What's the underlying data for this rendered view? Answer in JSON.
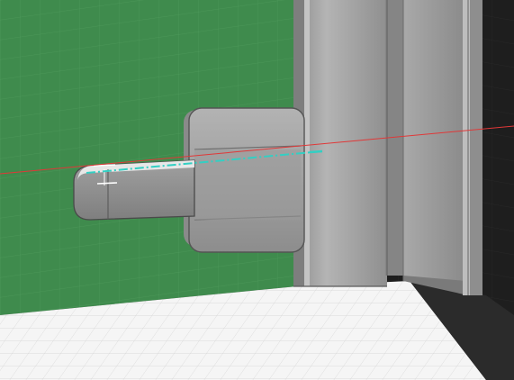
{
  "viewport": {
    "colors": {
      "background_dark": "#1e1e1e",
      "wall_green": "#3e8b4c",
      "floor_white": "#f4f4f4",
      "grid_line": "#d8d8d8",
      "metal_light": "#b9b9b9",
      "metal_mid": "#9c9c9c",
      "metal_dark": "#6f6f6f",
      "axis_x": "#e23a3a",
      "axis_cyan": "#34d0c4"
    }
  }
}
